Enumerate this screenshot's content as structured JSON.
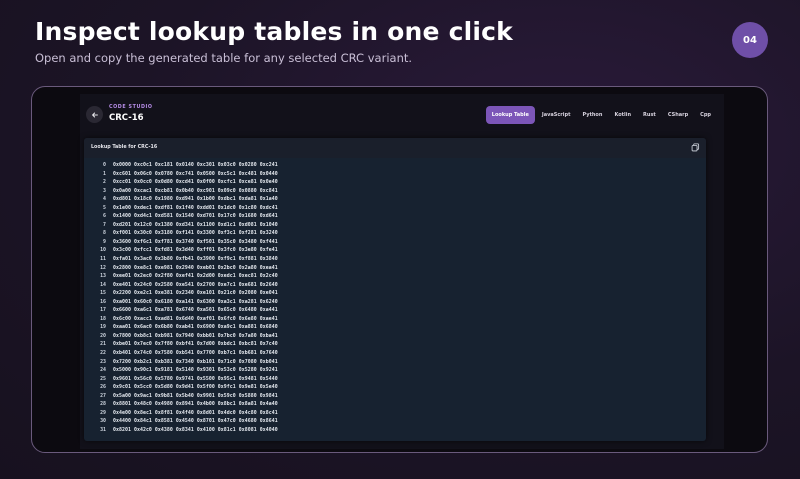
{
  "page": {
    "headline": "Inspect lookup tables in one click",
    "subline": "Open and copy the generated table for any selected CRC variant.",
    "badge": "04"
  },
  "app": {
    "studio_label": "CODE STUDIO",
    "title": "CRC-16",
    "back_icon": "arrow-left-icon",
    "tabs": [
      {
        "label": "Lookup Table",
        "active": true
      },
      {
        "label": "JavaScript",
        "active": false
      },
      {
        "label": "Python",
        "active": false
      },
      {
        "label": "Kotlin",
        "active": false
      },
      {
        "label": "Rust",
        "active": false
      },
      {
        "label": "CSharp",
        "active": false
      },
      {
        "label": "Cpp",
        "active": false
      }
    ],
    "panel": {
      "title": "Lookup Table for CRC-16",
      "copy_icon": "copy-icon"
    },
    "rows": [
      {
        "index": "0",
        "values": "0x0000 0xc0c1 0xc181 0x0140 0xc301 0x03c0 0x0280 0xc241"
      },
      {
        "index": "1",
        "values": "0xc601 0x06c0 0x0780 0xc741 0x0500 0xc5c1 0xc481 0x0440"
      },
      {
        "index": "2",
        "values": "0xcc01 0x0cc0 0x0d80 0xcd41 0x0f00 0xcfc1 0xce81 0x0e40"
      },
      {
        "index": "3",
        "values": "0x0a00 0xcac1 0xcb81 0x0b40 0xc901 0x09c0 0x0880 0xc841"
      },
      {
        "index": "4",
        "values": "0xd801 0x18c0 0x1980 0xd941 0x1b00 0xdbc1 0xda81 0x1a40"
      },
      {
        "index": "5",
        "values": "0x1e00 0xdec1 0xdf81 0x1f40 0xdd01 0x1dc0 0x1c80 0xdc41"
      },
      {
        "index": "6",
        "values": "0x1400 0xd4c1 0xd581 0x1540 0xd701 0x17c0 0x1680 0xd641"
      },
      {
        "index": "7",
        "values": "0xd201 0x12c0 0x1380 0xd341 0x1100 0xd1c1 0xd081 0x1040"
      },
      {
        "index": "8",
        "values": "0xf001 0x30c0 0x3180 0xf141 0x3300 0xf3c1 0xf281 0x3240"
      },
      {
        "index": "9",
        "values": "0x3600 0xf6c1 0xf781 0x3740 0xf501 0x35c0 0x3480 0xf441"
      },
      {
        "index": "10",
        "values": "0x3c00 0xfcc1 0xfd81 0x3d40 0xff01 0x3fc0 0x3e80 0xfe41"
      },
      {
        "index": "11",
        "values": "0xfa01 0x3ac0 0x3b80 0xfb41 0x3900 0xf9c1 0xf881 0x3840"
      },
      {
        "index": "12",
        "values": "0x2800 0xe8c1 0xe981 0x2940 0xeb01 0x2bc0 0x2a80 0xea41"
      },
      {
        "index": "13",
        "values": "0xee01 0x2ec0 0x2f80 0xef41 0x2d00 0xedc1 0xec81 0x2c40"
      },
      {
        "index": "14",
        "values": "0xe401 0x24c0 0x2580 0xe541 0x2700 0xe7c1 0xe681 0x2640"
      },
      {
        "index": "15",
        "values": "0x2200 0xe2c1 0xe381 0x2340 0xe101 0x21c0 0x2080 0xe041"
      },
      {
        "index": "16",
        "values": "0xa001 0x60c0 0x6180 0xa141 0x6300 0xa3c1 0xa281 0x6240"
      },
      {
        "index": "17",
        "values": "0x6600 0xa6c1 0xa781 0x6740 0xa501 0x65c0 0x6480 0xa441"
      },
      {
        "index": "18",
        "values": "0x6c00 0xacc1 0xad81 0x6d40 0xaf01 0x6fc0 0x6e80 0xae41"
      },
      {
        "index": "19",
        "values": "0xaa01 0x6ac0 0x6b80 0xab41 0x6900 0xa9c1 0xa881 0x6840"
      },
      {
        "index": "20",
        "values": "0x7800 0xb8c1 0xb981 0x7940 0xbb01 0x7bc0 0x7a80 0xba41"
      },
      {
        "index": "21",
        "values": "0xbe01 0x7ec0 0x7f80 0xbf41 0x7d00 0xbdc1 0xbc81 0x7c40"
      },
      {
        "index": "22",
        "values": "0xb401 0x74c0 0x7580 0xb541 0x7700 0xb7c1 0xb681 0x7640"
      },
      {
        "index": "23",
        "values": "0x7200 0xb2c1 0xb381 0x7340 0xb101 0x71c0 0x7080 0xb041"
      },
      {
        "index": "24",
        "values": "0x5000 0x90c1 0x9181 0x5140 0x9301 0x53c0 0x5280 0x9241"
      },
      {
        "index": "25",
        "values": "0x9601 0x56c0 0x5780 0x9741 0x5500 0x95c1 0x9481 0x5440"
      },
      {
        "index": "26",
        "values": "0x9c01 0x5cc0 0x5d80 0x9d41 0x5f00 0x9fc1 0x9e81 0x5e40"
      },
      {
        "index": "27",
        "values": "0x5a00 0x9ac1 0x9b81 0x5b40 0x9901 0x59c0 0x5880 0x9841"
      },
      {
        "index": "28",
        "values": "0x8801 0x48c0 0x4980 0x8941 0x4b00 0x8bc1 0x8a81 0x4a40"
      },
      {
        "index": "29",
        "values": "0x4e00 0x8ec1 0x8f81 0x4f40 0x8d01 0x4dc0 0x4c80 0x8c41"
      },
      {
        "index": "30",
        "values": "0x4400 0x84c1 0x8581 0x4540 0x8701 0x47c0 0x4680 0x8641"
      },
      {
        "index": "31",
        "values": "0x8201 0x42c0 0x4380 0x8341 0x4100 0x81c1 0x8081 0x4040"
      }
    ]
  },
  "colors": {
    "accent": "#7c56b8",
    "badge": "#6f4fa8",
    "panel_bg": "#172230",
    "app_bg": "#12111a"
  }
}
